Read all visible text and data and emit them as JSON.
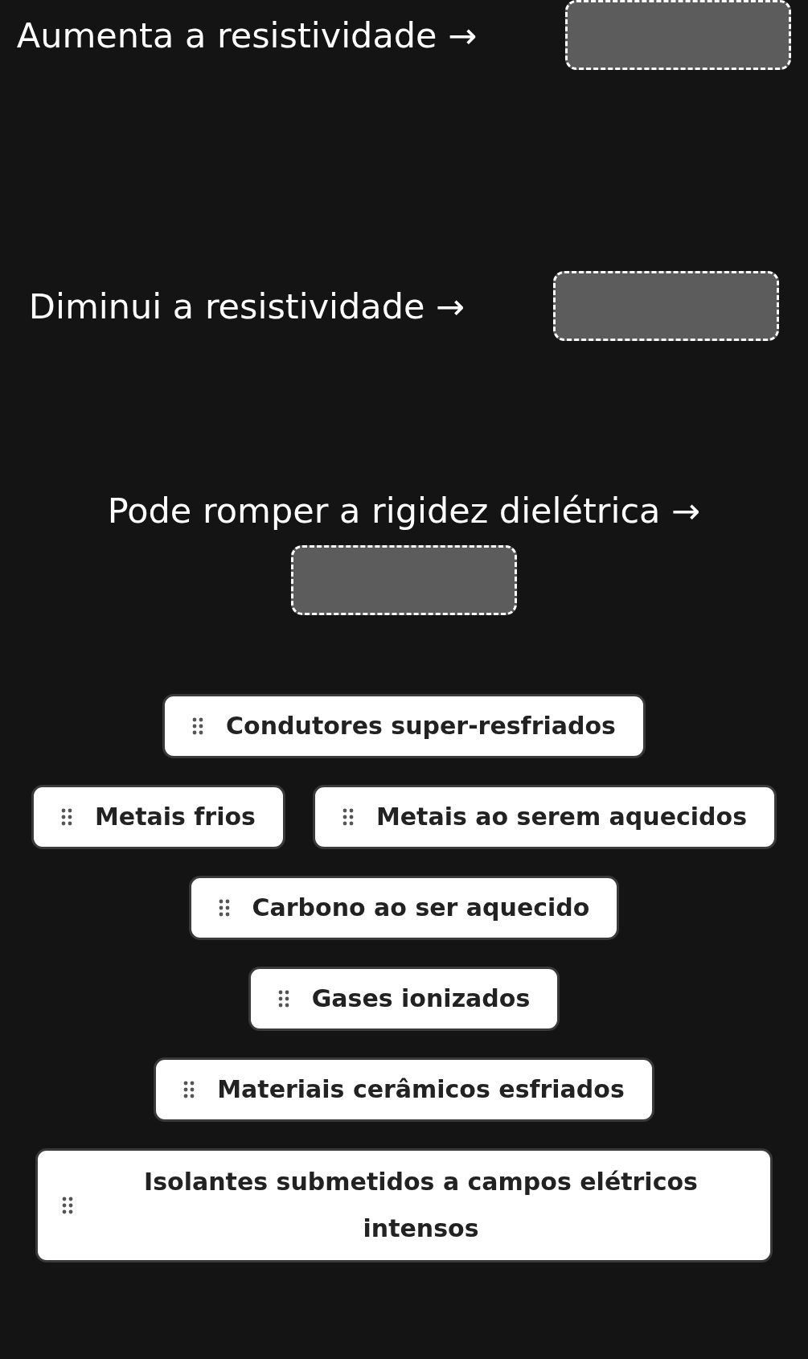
{
  "prompts": [
    {
      "text": "Aumenta a resistividade →"
    },
    {
      "text": "Diminui a resistividade →"
    },
    {
      "text": "Pode romper a rigidez dielétrica →"
    }
  ],
  "option_rows": [
    [
      {
        "label": "Condutores super-resfriados"
      }
    ],
    [
      {
        "label": "Metais frios"
      },
      {
        "label": "Metais ao serem aquecidos"
      }
    ],
    [
      {
        "label": "Carbono ao ser aquecido"
      }
    ],
    [
      {
        "label": "Gases ionizados"
      }
    ],
    [
      {
        "label": "Materiais cerâmicos esfriados"
      }
    ],
    [
      {
        "label": "Isolantes submetidos a campos elétricos intensos"
      }
    ]
  ]
}
